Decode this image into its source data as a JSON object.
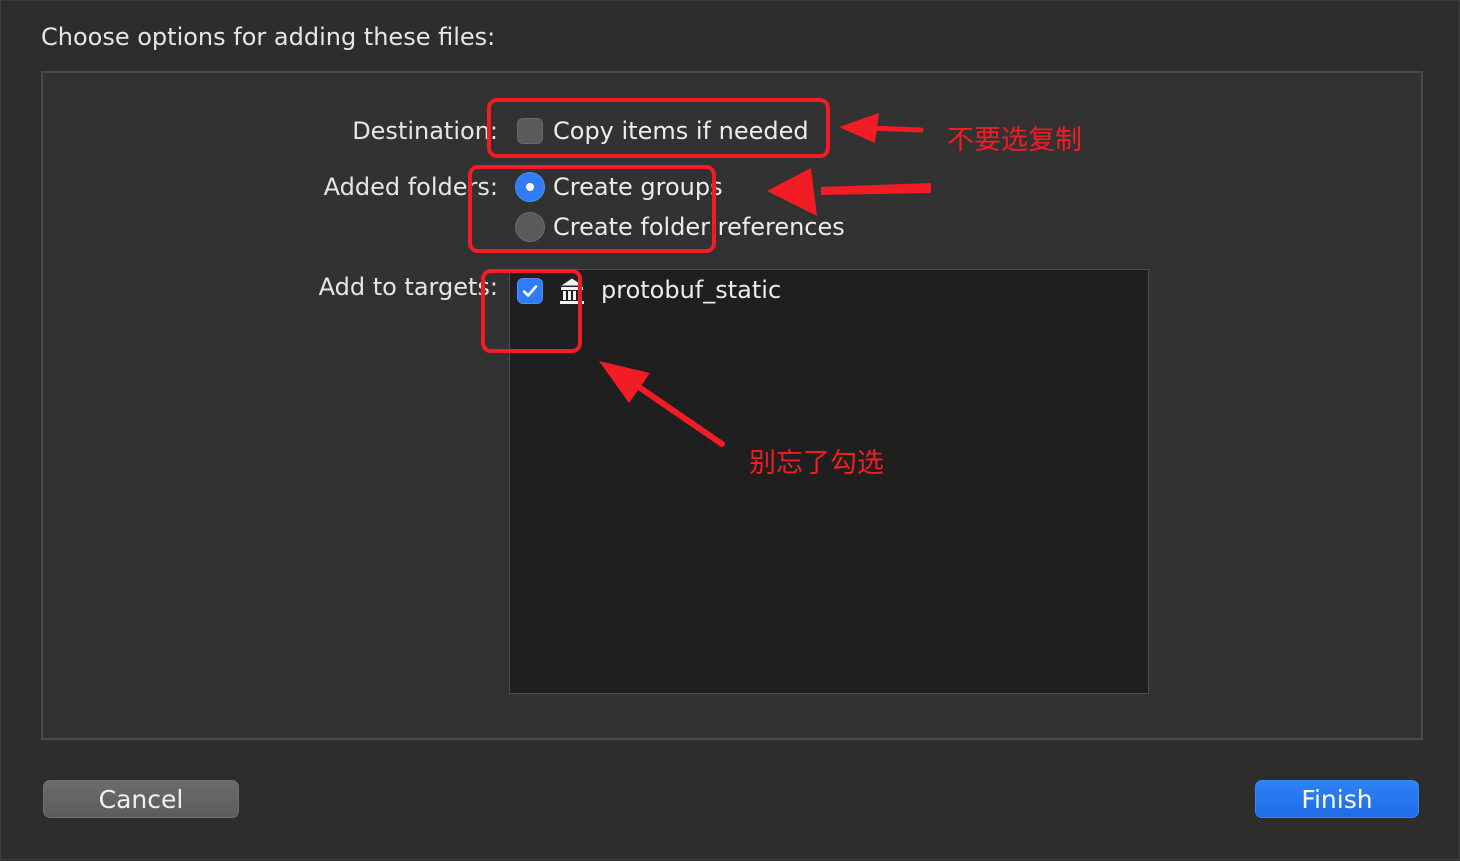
{
  "header": {
    "title": "Choose options for adding these files:"
  },
  "options": {
    "destination": {
      "label": "Destination:",
      "checkbox_label": "Copy items if needed",
      "checked": false
    },
    "added_folders": {
      "label": "Added folders:",
      "options": [
        {
          "label": "Create groups",
          "selected": true
        },
        {
          "label": "Create folder references",
          "selected": false
        }
      ]
    },
    "targets": {
      "label": "Add to targets:",
      "items": [
        {
          "name": "protobuf_static",
          "checked": true,
          "icon": "library-icon"
        }
      ]
    }
  },
  "buttons": {
    "cancel": "Cancel",
    "finish": "Finish"
  },
  "annotations": {
    "copy_note": "不要选复制",
    "target_note": "别忘了勾选",
    "color": "#f21c24"
  },
  "colors": {
    "accent": "#2f7cf6",
    "background": "#2d2d2d",
    "list_background": "#1f1f1f"
  }
}
